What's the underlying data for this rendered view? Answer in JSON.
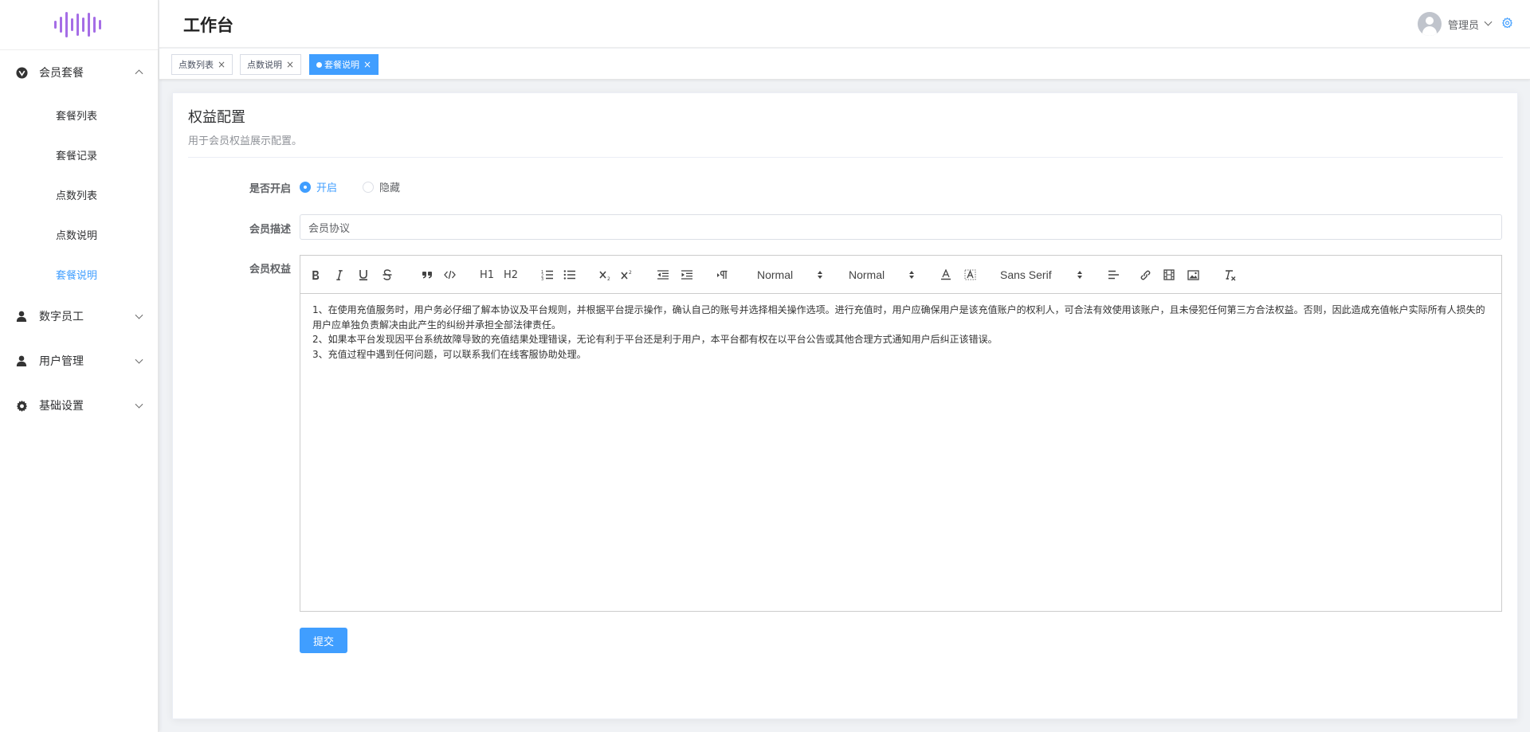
{
  "header": {
    "title": "工作台",
    "user_name": "管理员"
  },
  "sidebar": {
    "groups": [
      {
        "label": "会员套餐",
        "icon": "vip-icon",
        "expanded": true,
        "items": [
          {
            "label": "套餐列表"
          },
          {
            "label": "套餐记录"
          },
          {
            "label": "点数列表"
          },
          {
            "label": "点数说明"
          },
          {
            "label": "套餐说明",
            "active": true
          }
        ]
      },
      {
        "label": "数字员工",
        "icon": "person-icon",
        "expanded": false
      },
      {
        "label": "用户管理",
        "icon": "person-icon",
        "expanded": false
      },
      {
        "label": "基础设置",
        "icon": "gear-icon",
        "expanded": false
      }
    ]
  },
  "tags": [
    {
      "label": "点数列表",
      "close": "×"
    },
    {
      "label": "点数说明",
      "close": "×"
    },
    {
      "label": "套餐说明",
      "close": "×",
      "active": true
    }
  ],
  "card": {
    "title": "权益配置",
    "description": "用于会员权益展示配置。"
  },
  "form": {
    "enabled_label": "是否开启",
    "radio_on": "开启",
    "radio_off": "隐藏",
    "selected": "开启",
    "desc_label": "会员描述",
    "desc_value": "会员协议",
    "rights_label": "会员权益",
    "submit": "提交"
  },
  "editor": {
    "toolbar": {
      "h1": "H1",
      "h2": "H2",
      "header_select": "Normal",
      "size_select": "Normal",
      "font_select": "Sans Serif"
    },
    "paragraphs": [
      "1、在使用充值服务时，用户务必仔细了解本协议及平台规则，并根据平台提示操作，确认自己的账号并选择相关操作选项。进行充值时，用户应确保用户是该充值账户的权利人，可合法有效使用该账户，且未侵犯任何第三方合法权益。否则，因此造成充值帐户实际所有人损失的用户应单独负责解决由此产生的纠纷并承担全部法律责任。",
      "2、如果本平台发现因平台系统故障导致的充值结果处理错误，无论有利于平台还是利于用户，本平台都有权在以平台公告或其他合理方式通知用户后纠正该错误。",
      "3、充值过程中遇到任何问题，可以联系我们在线客服协助处理。"
    ]
  },
  "colors": {
    "primary": "#409eff",
    "logo_purple": "#a56de6"
  }
}
